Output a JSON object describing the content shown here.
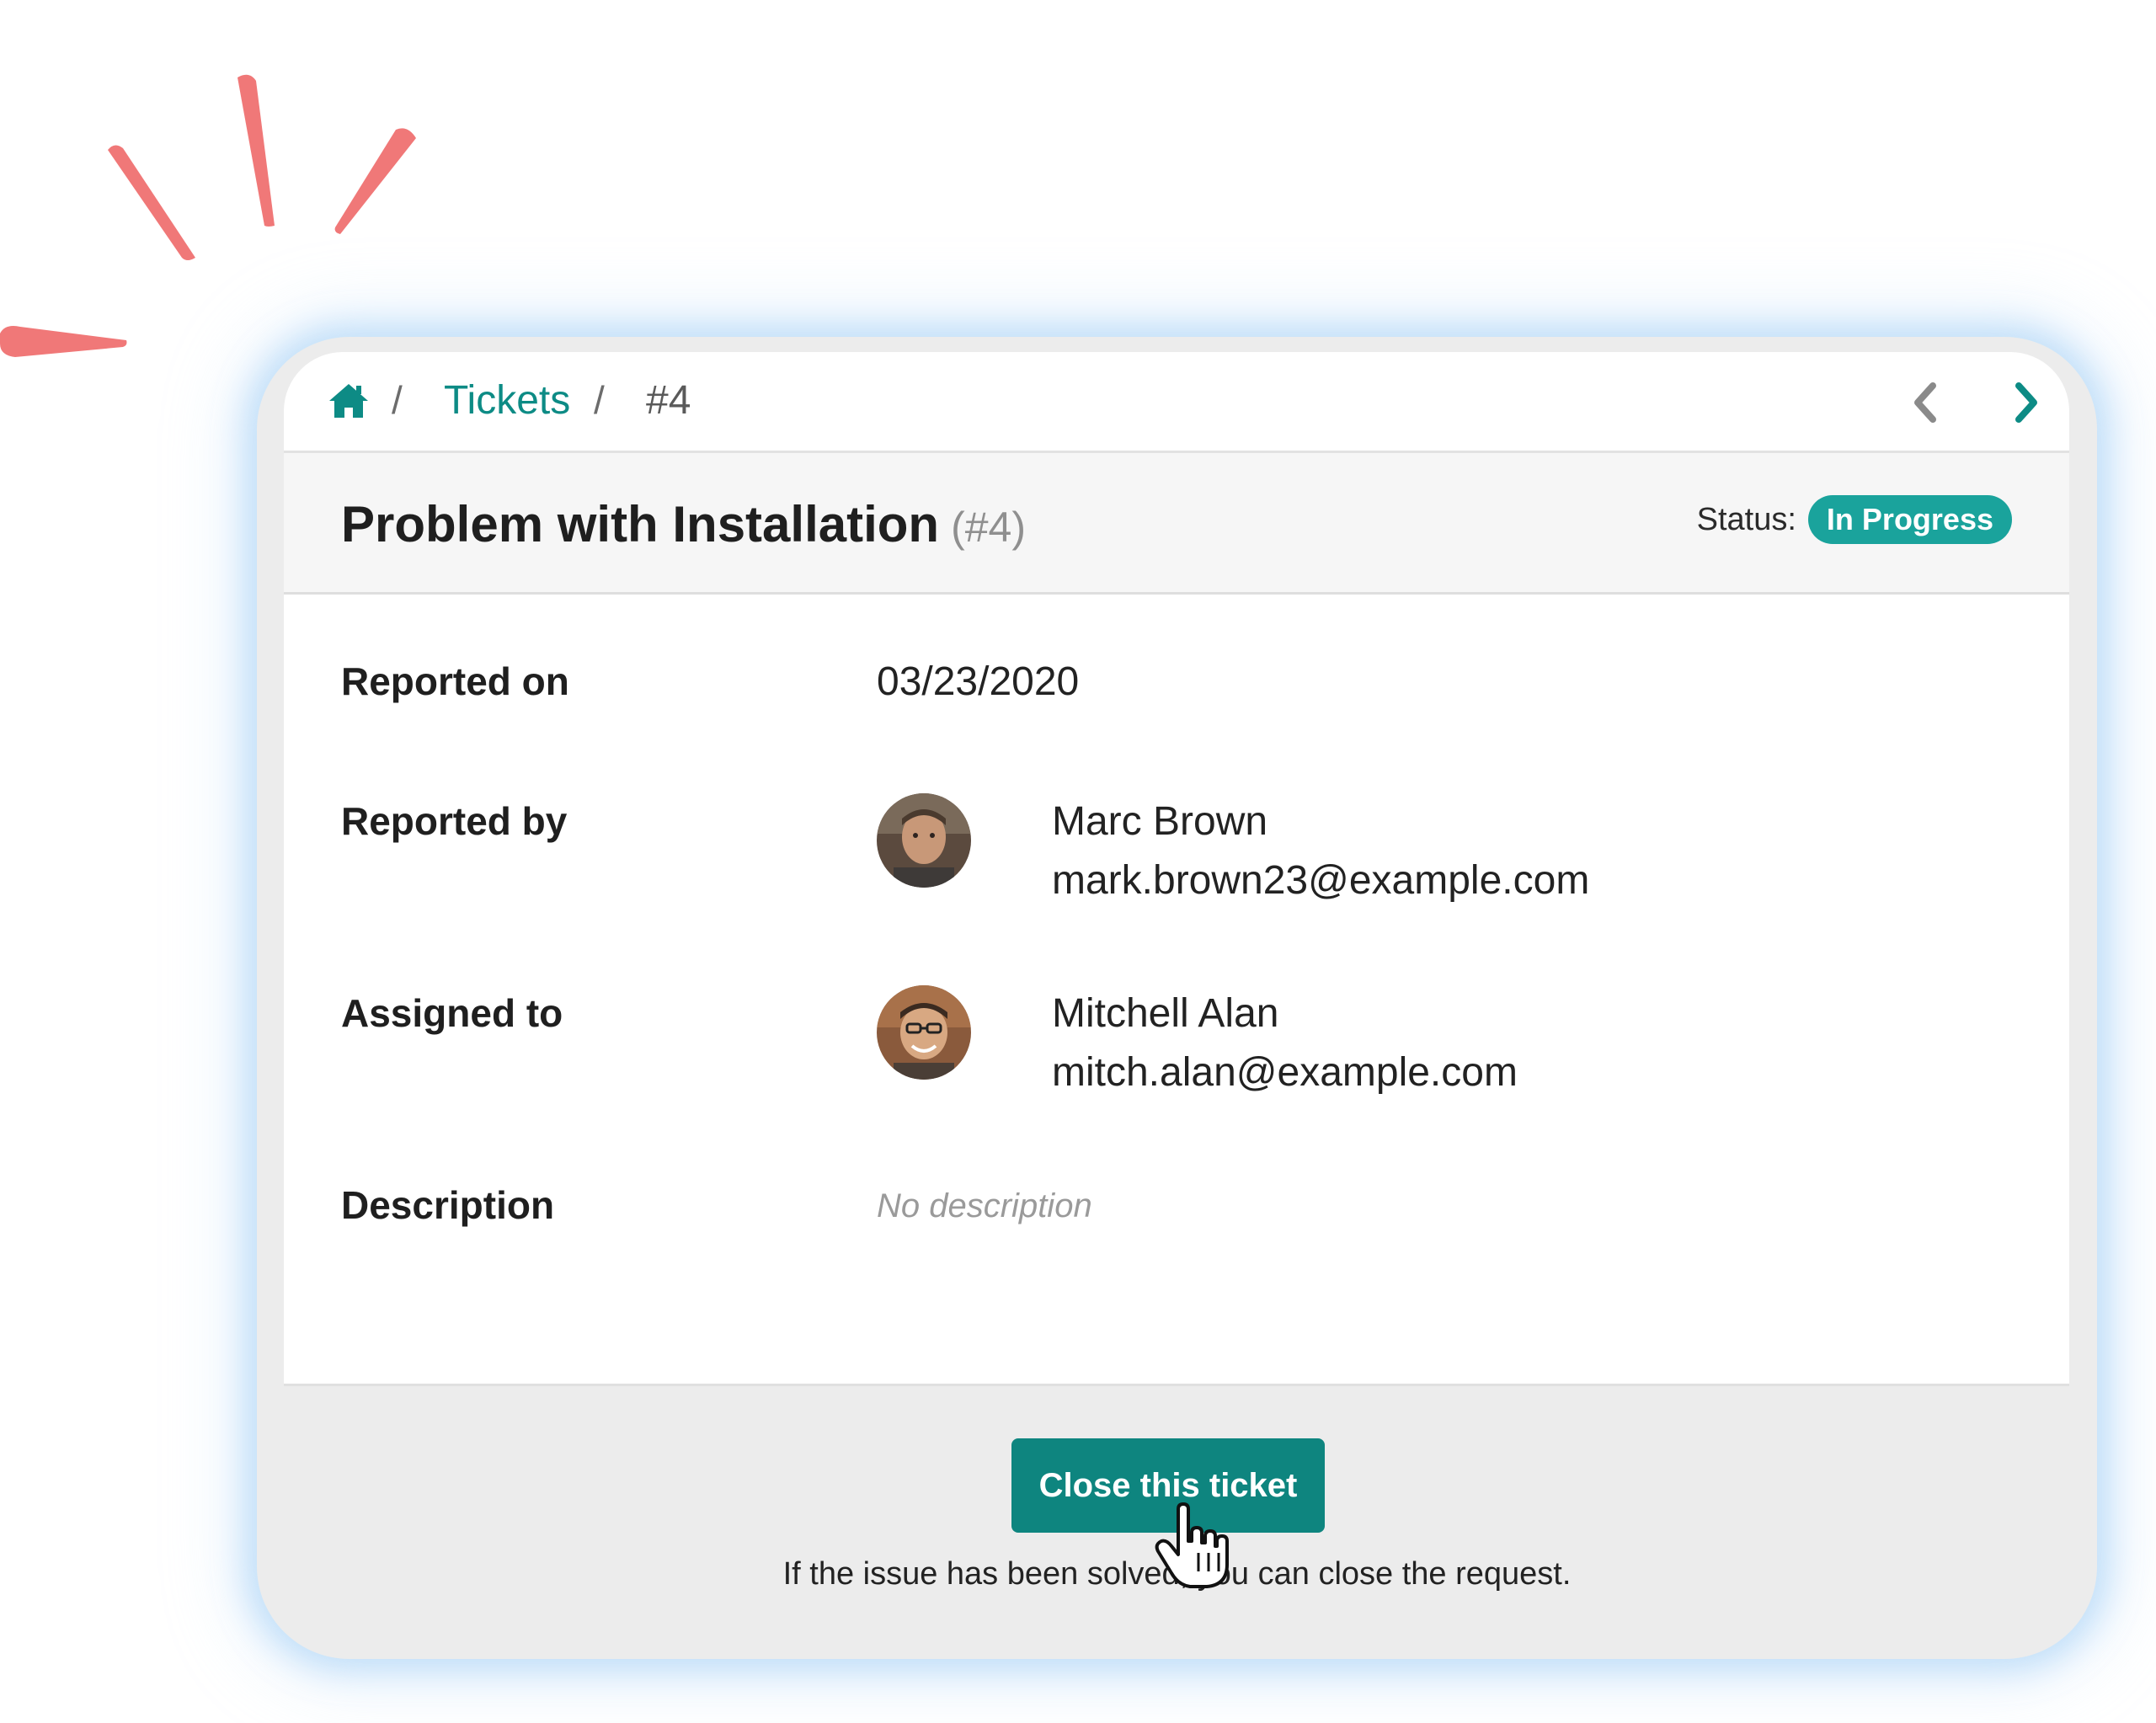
{
  "breadcrumb": {
    "home_icon": "home-icon",
    "separator": "/",
    "tickets_label": "Tickets",
    "current": "#4",
    "prev_icon": "chevron-left-icon",
    "next_icon": "chevron-right-icon"
  },
  "ticket": {
    "title": "Problem with Installation",
    "number": "(#4)",
    "status_label": "Status:",
    "status": "In Progress"
  },
  "details": {
    "reported_on_label": "Reported on",
    "reported_on": "03/23/2020",
    "reported_by_label": "Reported by",
    "reporter": {
      "name": "Marc Brown",
      "email": "mark.brown23@example.com"
    },
    "assigned_to_label": "Assigned to",
    "assignee": {
      "name": "Mitchell Alan",
      "email": "mitch.alan@example.com"
    },
    "description_label": "Description",
    "description": "No description"
  },
  "footer": {
    "close_button": "Close this ticket",
    "hint": "If the issue has been solved, you can close the request."
  },
  "colors": {
    "accent": "#0e857f",
    "badge": "#1aa39c",
    "burst": "#f07878"
  }
}
